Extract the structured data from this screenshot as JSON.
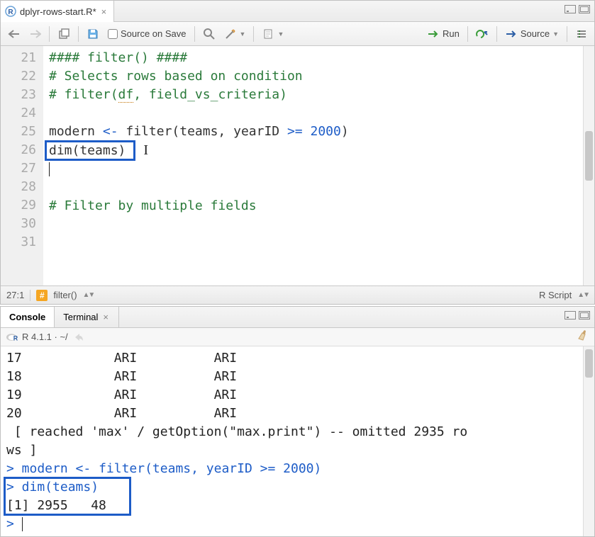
{
  "source": {
    "tab_filename": "dplyr-rows-start.R*",
    "toolbar": {
      "source_on_save": "Source on Save",
      "run": "Run",
      "source": "Source"
    },
    "code_lines": [
      {
        "n": 21,
        "type": "comment",
        "text": "#### filter() ####"
      },
      {
        "n": 22,
        "type": "comment",
        "text": "# Selects rows based on condition"
      },
      {
        "n": 23,
        "type": "comment",
        "prefix": "# filter(",
        "underlined": "df",
        "suffix": ", field_vs_criteria)"
      },
      {
        "n": 24,
        "type": "blank",
        "text": ""
      },
      {
        "n": 25,
        "type": "code",
        "tokens": [
          {
            "t": "modern ",
            "c": ""
          },
          {
            "t": "<-",
            "c": "blue"
          },
          {
            "t": " filter(teams, yearID ",
            "c": ""
          },
          {
            "t": ">=",
            "c": "blue"
          },
          {
            "t": " ",
            "c": ""
          },
          {
            "t": "2000",
            "c": "num"
          },
          {
            "t": ")",
            "c": ""
          }
        ]
      },
      {
        "n": 26,
        "type": "code",
        "tokens": [
          {
            "t": "dim(teams)",
            "c": ""
          }
        ],
        "ibeam_after": true
      },
      {
        "n": 27,
        "type": "cursor",
        "text": ""
      },
      {
        "n": 28,
        "type": "blank",
        "text": ""
      },
      {
        "n": 29,
        "type": "comment",
        "text": "# Filter by multiple fields"
      },
      {
        "n": 30,
        "type": "blank",
        "text": ""
      },
      {
        "n": 31,
        "type": "blank",
        "text": ""
      }
    ],
    "status": {
      "position": "27:1",
      "section": "filter()",
      "filetype": "R Script"
    }
  },
  "console": {
    "tabs": {
      "console": "Console",
      "terminal": "Terminal"
    },
    "info": "R 4.1.1 · ~/",
    "lines": [
      "17            ARI          ARI",
      "18            ARI          ARI",
      "19            ARI          ARI",
      "20            ARI          ARI",
      " [ reached 'max' / getOption(\"max.print\") -- omitted 2935 ro",
      "ws ]"
    ],
    "cmd1_tokens": [
      {
        "t": "> modern ",
        "c": "console-blue"
      },
      {
        "t": "<-",
        "c": "console-blue"
      },
      {
        "t": " filter(teams, yearID >= ",
        "c": "console-blue"
      },
      {
        "t": "2000",
        "c": "console-blue"
      },
      {
        "t": ")",
        "c": "console-blue"
      }
    ],
    "cmd2": "> dim(teams)",
    "result": "[1] 2955   48",
    "prompt": "> "
  }
}
